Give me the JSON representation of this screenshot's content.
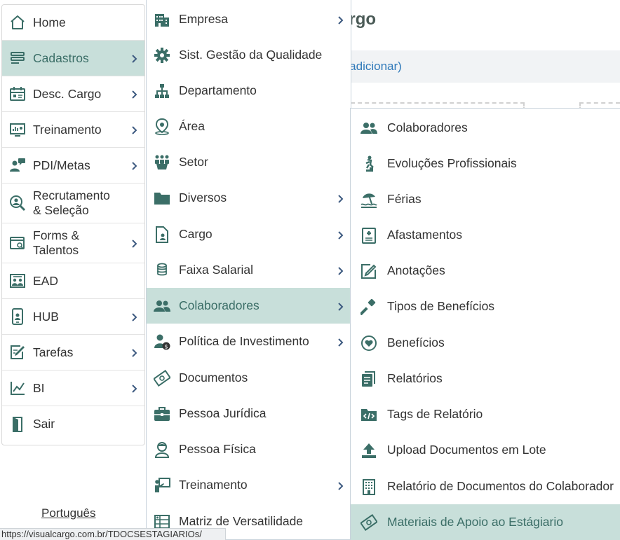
{
  "background": {
    "title_fragment": "argo",
    "link_fragment": "o adicionar)"
  },
  "main_menu": [
    {
      "label": "Home",
      "icon": "home-icon"
    },
    {
      "label": "Cadastros",
      "icon": "stack-icon"
    },
    {
      "label": "Desc. Cargo",
      "icon": "calendar-icon"
    },
    {
      "label": "Treinamento",
      "icon": "presentation-icon"
    },
    {
      "label": "PDI/Metas",
      "icon": "user-chat-icon"
    },
    {
      "label": "Recrutamento\n& Seleção",
      "icon": "user-search-icon"
    },
    {
      "label": "Forms &\nTalentos",
      "icon": "window-search-icon"
    },
    {
      "label": "EAD",
      "icon": "classroom-icon"
    },
    {
      "label": "HUB",
      "icon": "mobile-icon"
    },
    {
      "label": "Tarefas",
      "icon": "edit-icon"
    },
    {
      "label": "BI",
      "icon": "chart-icon"
    },
    {
      "label": "Sair",
      "icon": "exit-icon"
    }
  ],
  "cadastros_menu": [
    {
      "label": "Empresa",
      "icon": "building-icon"
    },
    {
      "label": "Sist. Gestão da Qualidade",
      "icon": "gear-icon"
    },
    {
      "label": "Departamento",
      "icon": "org-chart-icon"
    },
    {
      "label": "Área",
      "icon": "map-pin-icon"
    },
    {
      "label": "Setor",
      "icon": "people-group-icon"
    },
    {
      "label": "Diversos",
      "icon": "folder-icon"
    },
    {
      "label": "Cargo",
      "icon": "file-user-icon"
    },
    {
      "label": "Faixa Salarial",
      "icon": "coins-icon"
    },
    {
      "label": "Colaboradores",
      "icon": "users-icon"
    },
    {
      "label": "Política de Investimento",
      "icon": "user-money-icon"
    },
    {
      "label": "Documentos",
      "icon": "money-bill-icon"
    },
    {
      "label": "Pessoa Jurídica",
      "icon": "briefcase-icon"
    },
    {
      "label": "Pessoa Física",
      "icon": "person-icon"
    },
    {
      "label": "Treinamento",
      "icon": "teacher-icon"
    },
    {
      "label": "Matriz de Versatilidade",
      "icon": "matrix-icon"
    }
  ],
  "colaboradores_menu": [
    {
      "label": "Colaboradores",
      "icon": "users-icon"
    },
    {
      "label": "Evoluções Profissionais",
      "icon": "stairs-icon"
    },
    {
      "label": "Férias",
      "icon": "umbrella-beach-icon"
    },
    {
      "label": "Afastamentos",
      "icon": "medical-file-icon"
    },
    {
      "label": "Anotações",
      "icon": "pencil-icon"
    },
    {
      "label": "Tipos de Benefícios",
      "icon": "hammer-icon"
    },
    {
      "label": "Benefícios",
      "icon": "heart-circle-icon"
    },
    {
      "label": "Relatórios",
      "icon": "report-icon"
    },
    {
      "label": "Tags de Relatório",
      "icon": "code-folder-icon"
    },
    {
      "label": "Upload Documentos em Lote",
      "icon": "upload-icon"
    },
    {
      "label": "Relatório de Documentos do Colaborador",
      "icon": "building-doc-icon"
    },
    {
      "label": "Materiais de Apoio ao Estágiario",
      "icon": "money-bill-icon"
    }
  ],
  "footer": {
    "language": "Português",
    "status_url": "https://visualcargo.com.br/TDOCSESTAGIARIOs/"
  },
  "colors": {
    "accent": "#3b6e67",
    "active_bg": "#c8dfda",
    "chevron": "#3d5a80",
    "link": "#2f79b9"
  }
}
